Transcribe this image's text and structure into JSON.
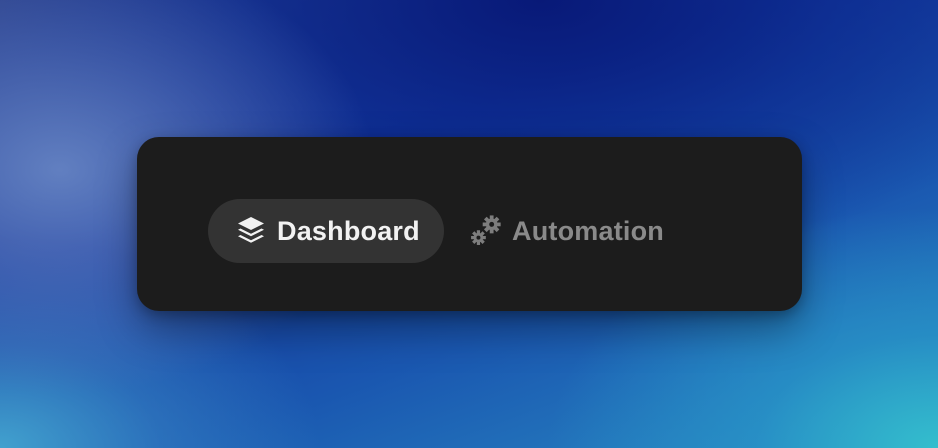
{
  "tabs": [
    {
      "label": "Dashboard",
      "icon": "layers-icon",
      "active": true
    },
    {
      "label": "Automation",
      "icon": "gears-icon",
      "active": false
    }
  ],
  "colors": {
    "panel": "#1c1c1c",
    "active_pill": "#333333",
    "active_text": "#f2f2f2",
    "inactive_text": "#8a8a8a"
  }
}
